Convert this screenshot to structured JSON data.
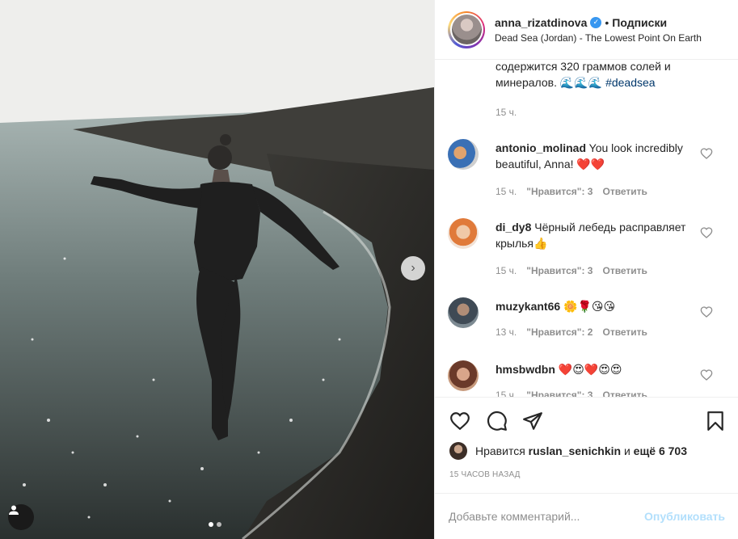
{
  "post": {
    "username": "anna_rizatdinova",
    "separator": "•",
    "follow_label": "Подписки",
    "location": "Dead Sea (Jordan) - The Lowest Point On Earth"
  },
  "caption": {
    "text": "содержится 320 граммов солей и минералов. 🌊🌊🌊",
    "hashtag": "#deadsea",
    "time": "15 ч."
  },
  "comments": [
    {
      "user": "antonio_molinad",
      "text": "You look incredibly beautiful, Anna! ❤️❤️",
      "time": "15 ч.",
      "likes": "\"Нравится\": 3",
      "reply": "Ответить"
    },
    {
      "user": "di_dy8",
      "text": "Чёрный лебедь расправляет крылья👍",
      "time": "15 ч.",
      "likes": "\"Нравится\": 3",
      "reply": "Ответить"
    },
    {
      "user": "muzykant66",
      "text": "🌼🌹😘😘",
      "time": "13 ч.",
      "likes": "\"Нравится\": 2",
      "reply": "Ответить"
    },
    {
      "user": "hmsbwdbn",
      "text": "❤️😍❤️😍😍",
      "time": "15 ч.",
      "likes": "\"Нравится\": 3",
      "reply": "Ответить"
    }
  ],
  "likes": {
    "prefix": "Нравится",
    "user": "ruslan_senichkin",
    "middle": "и",
    "rest": "ещё 6 703"
  },
  "timestamp": "15 ЧАСОВ НАЗАД",
  "add_comment": {
    "placeholder": "Добавьте комментарий...",
    "publish_label": "Опубликовать"
  },
  "colors": {
    "link": "#00376b",
    "publish_disabled": "#b2dffc",
    "muted": "#8e8e8e",
    "verified": "#3897f0"
  },
  "icons": [
    "heart-icon",
    "comment-icon",
    "share-icon",
    "bookmark-icon",
    "verified-icon",
    "chevron-right-icon",
    "user-tag-icon"
  ]
}
